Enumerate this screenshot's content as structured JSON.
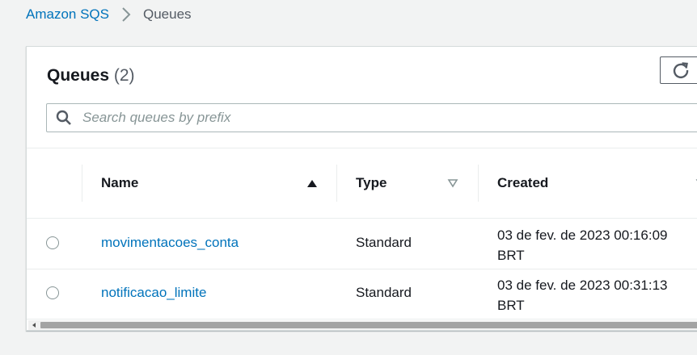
{
  "breadcrumb": {
    "root": "Amazon SQS",
    "current": "Queues"
  },
  "panel": {
    "title": "Queues",
    "count": "(2)",
    "refresh_icon": "refresh-icon"
  },
  "search": {
    "placeholder": "Search queues by prefix",
    "value": ""
  },
  "table": {
    "columns": [
      {
        "label": "Name",
        "sort": "ascending"
      },
      {
        "label": "Type",
        "sort": "none"
      },
      {
        "label": "Created",
        "sort": "none"
      }
    ],
    "rows": [
      {
        "name": "movimentacoes_conta",
        "type": "Standard",
        "created_line1": "03 de fev. de 2023 00:16:09",
        "created_line2": "BRT",
        "selected": false
      },
      {
        "name": "notificacao_limite",
        "type": "Standard",
        "created_line1": "03 de fev. de 2023 00:31:13",
        "created_line2": "BRT",
        "selected": false
      }
    ]
  },
  "colors": {
    "link": "#0073bb",
    "background": "#f2f3f3",
    "border": "#eaeded"
  }
}
